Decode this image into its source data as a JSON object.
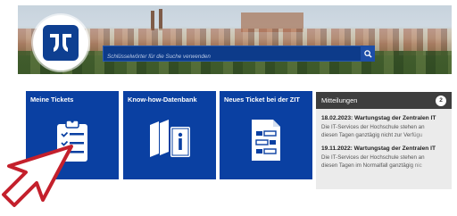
{
  "header": {
    "search_placeholder": "Schlüsselwörter für die Suche verwenden"
  },
  "tiles": [
    {
      "label": "Meine Tickets",
      "icon": "clipboard-checklist-icon"
    },
    {
      "label": "Know-how-Datenbank",
      "icon": "books-info-icon"
    },
    {
      "label": "Neues Ticket bei der ZIT",
      "icon": "form-document-icon"
    }
  ],
  "news": {
    "title": "Mitteilungen",
    "count": "2",
    "items": [
      {
        "title": "18.02.2023: Wartungstag der Zentralen IT",
        "line1": "Die IT-Services der Hochschule stehen an",
        "line2": "diesen Tagen ganztägig nicht zur Verfügu"
      },
      {
        "title": "19.11.2022: Wartungstag der Zentralen IT",
        "line1": "Die IT-Services der Hochschule stehen an",
        "line2": "diesen Tagen im Normalfall ganztägig nic"
      }
    ]
  },
  "colors": {
    "tile": "#0a40a2",
    "news_header": "#3e3e3e",
    "cursor": "#c4202c"
  }
}
